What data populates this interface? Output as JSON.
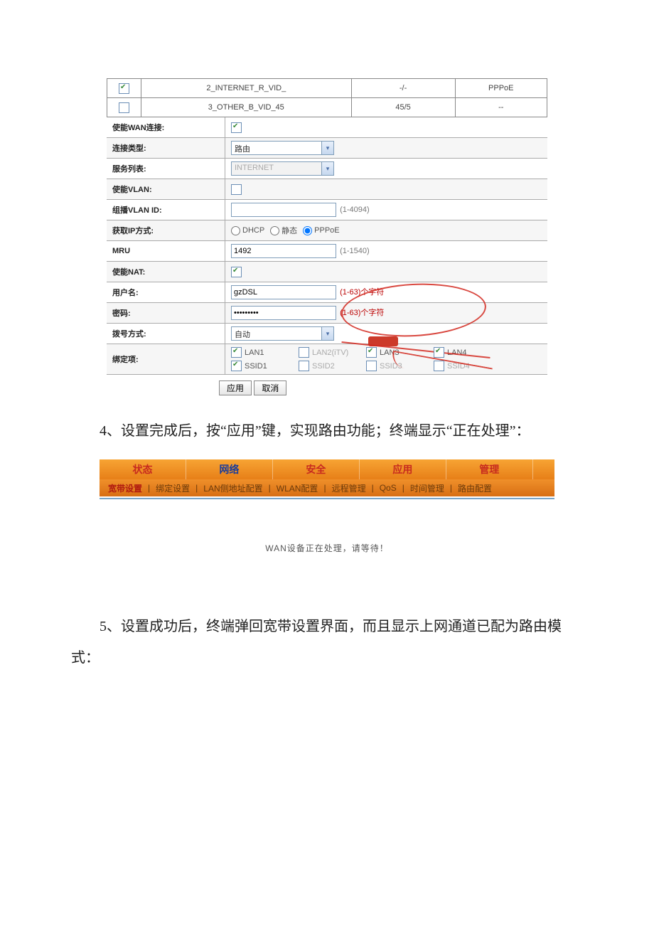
{
  "header_rows": [
    {
      "checked": true,
      "name": "2_INTERNET_R_VID_",
      "vlan": "-/-",
      "mode": "PPPoE"
    },
    {
      "checked": false,
      "name": "3_OTHER_B_VID_45",
      "vlan": "45/5",
      "mode": "--"
    }
  ],
  "form": {
    "enable_wan": {
      "label": "使能WAN连接:",
      "checked": true
    },
    "conn_type": {
      "label": "连接类型:",
      "value": "路由"
    },
    "service_list": {
      "label": "服务列表:",
      "value": "INTERNET",
      "disabled": true
    },
    "enable_vlan": {
      "label": "使能VLAN:",
      "checked": false
    },
    "mcast_vlan": {
      "label": "组播VLAN ID:",
      "value": "",
      "hint": "(1-4094)"
    },
    "ip_mode": {
      "label": "获取IP方式:",
      "options": [
        "DHCP",
        "静态",
        "PPPoE"
      ],
      "selected": "PPPoE"
    },
    "mru": {
      "label": "MRU",
      "value": "1492",
      "hint": "(1-1540)"
    },
    "enable_nat": {
      "label": "使能NAT:",
      "checked": true
    },
    "username": {
      "label": "用户名:",
      "value": "gzDSL",
      "hint": "(1-63)个字符"
    },
    "password": {
      "label": "密码:",
      "value": "•••••••••",
      "hint": "(1-63)个字符"
    },
    "dial_mode": {
      "label": "拨号方式:",
      "value": "自动"
    },
    "bindings": {
      "label": "绑定项:",
      "items": [
        {
          "name": "LAN1",
          "checked": true,
          "disabled": false
        },
        {
          "name": "LAN2(iTV)",
          "checked": false,
          "disabled": true
        },
        {
          "name": "LAN3",
          "checked": true,
          "disabled": false
        },
        {
          "name": "LAN4",
          "checked": true,
          "disabled": false
        },
        {
          "name": "SSID1",
          "checked": true,
          "disabled": false
        },
        {
          "name": "SSID2",
          "checked": false,
          "disabled": true
        },
        {
          "name": "SSID3",
          "checked": false,
          "disabled": true
        },
        {
          "name": "SSID4",
          "checked": false,
          "disabled": true
        }
      ]
    },
    "buttons": {
      "apply": "应用",
      "cancel": "取消"
    }
  },
  "paragraph_4": "4、设置完成后，按“应用”键，实现路由功能；终端显示“正在处理”：",
  "tabs": {
    "main": [
      "状态",
      "网络",
      "安全",
      "应用",
      "管理"
    ],
    "main_active": 1,
    "sub": [
      "宽带设置",
      "绑定设置",
      "LAN侧地址配置",
      "WLAN配置",
      "远程管理",
      "QoS",
      "时间管理",
      "路由配置"
    ],
    "sub_active": 0
  },
  "processing_msg": "WAN设备正在处理，请等待！",
  "paragraph_5": "5、设置成功后，终端弹回宽带设置界面，而且显示上网通道已配为路由模式："
}
